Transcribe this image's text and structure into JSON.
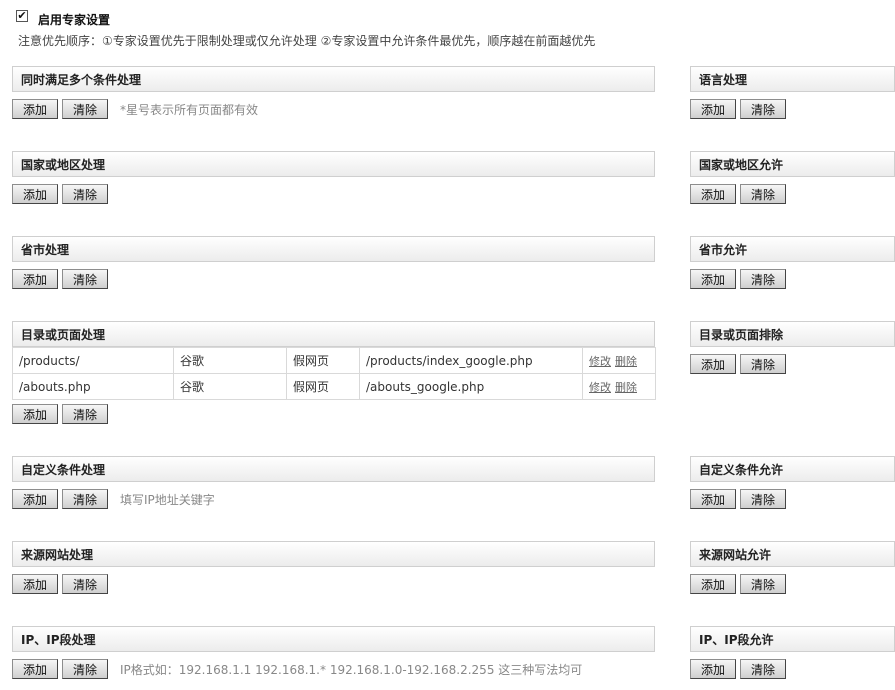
{
  "header": {
    "checkbox_mark": "✔",
    "title": "启用专家设置",
    "note": "注意优先顺序：①专家设置优先于限制处理或仅允许处理 ②专家设置中允许条件最优先，顺序越在前面越优先"
  },
  "buttons": {
    "add": "添加",
    "clear": "清除"
  },
  "left": {
    "multi": {
      "title": "同时满足多个条件处理",
      "hint": "*星号表示所有页面都有效"
    },
    "country": {
      "title": "国家或地区处理"
    },
    "province": {
      "title": "省市处理"
    },
    "dir": {
      "title": "目录或页面处理",
      "rows": [
        {
          "path": "/products/",
          "engine": "谷歌",
          "type": "假网页",
          "target": "/products/index_google.php",
          "edit": "修改",
          "delete": "删除"
        },
        {
          "path": "/abouts.php",
          "engine": "谷歌",
          "type": "假网页",
          "target": "/abouts_google.php",
          "edit": "修改",
          "delete": "删除"
        }
      ]
    },
    "custom": {
      "title": "自定义条件处理",
      "hint": "填写IP地址关键字"
    },
    "source": {
      "title": "来源网站处理"
    },
    "ip": {
      "title": "IP、IP段处理",
      "hint": "IP格式如：192.168.1.1    192.168.1.*    192.168.1.0-192.168.2.255 这三种写法均可"
    }
  },
  "right": {
    "lang": {
      "title": "语言处理"
    },
    "country": {
      "title": "国家或地区允许"
    },
    "province": {
      "title": "省市允许"
    },
    "dir": {
      "title": "目录或页面排除"
    },
    "custom": {
      "title": "自定义条件允许"
    },
    "source": {
      "title": "来源网站允许"
    },
    "ip": {
      "title": "IP、IP段允许"
    }
  }
}
